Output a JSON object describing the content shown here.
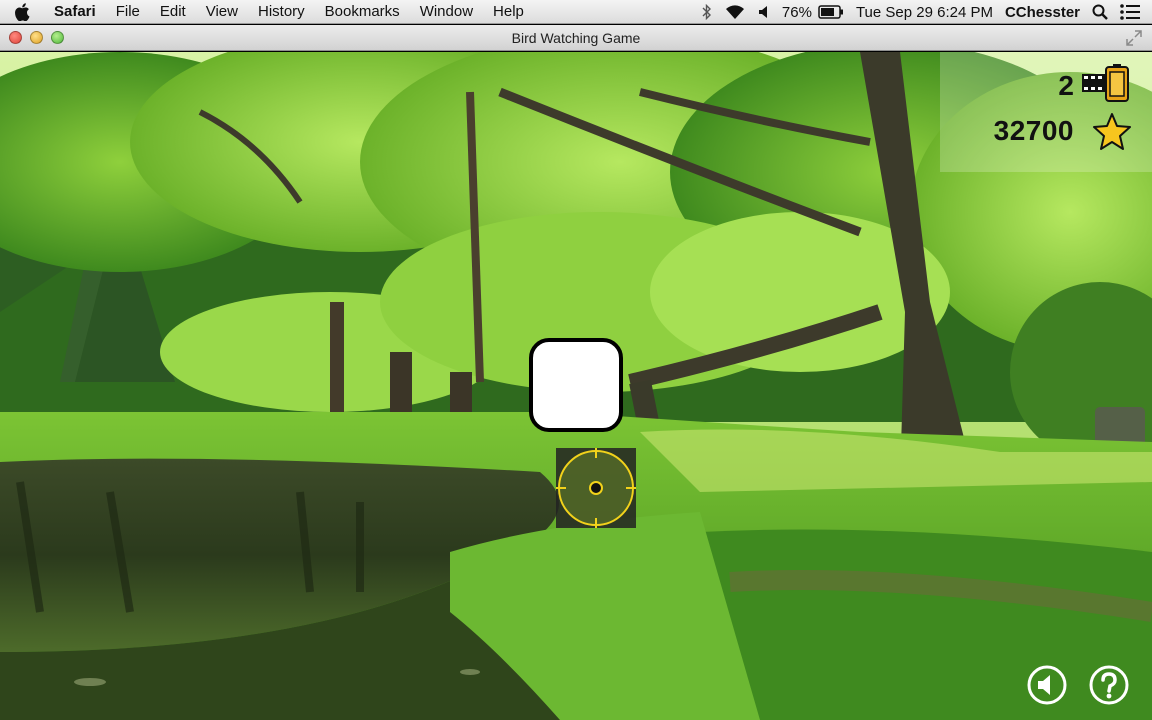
{
  "menubar": {
    "app_name": "Safari",
    "items": [
      "File",
      "Edit",
      "View",
      "History",
      "Bookmarks",
      "Window",
      "Help"
    ],
    "battery": "76%",
    "datetime": "Tue Sep 29  6:24 PM",
    "user": "CChesster"
  },
  "window": {
    "title": "Bird Watching Game"
  },
  "hud": {
    "film_remaining": "2",
    "score": "32700"
  },
  "icons": {
    "film": "film-roll-icon",
    "score": "star-icon",
    "sound": "speaker-icon",
    "help": "question-mark-icon"
  },
  "colors": {
    "reticle": "#f2d21b",
    "star": "#f7c51e",
    "grass": "#5fae2a"
  }
}
